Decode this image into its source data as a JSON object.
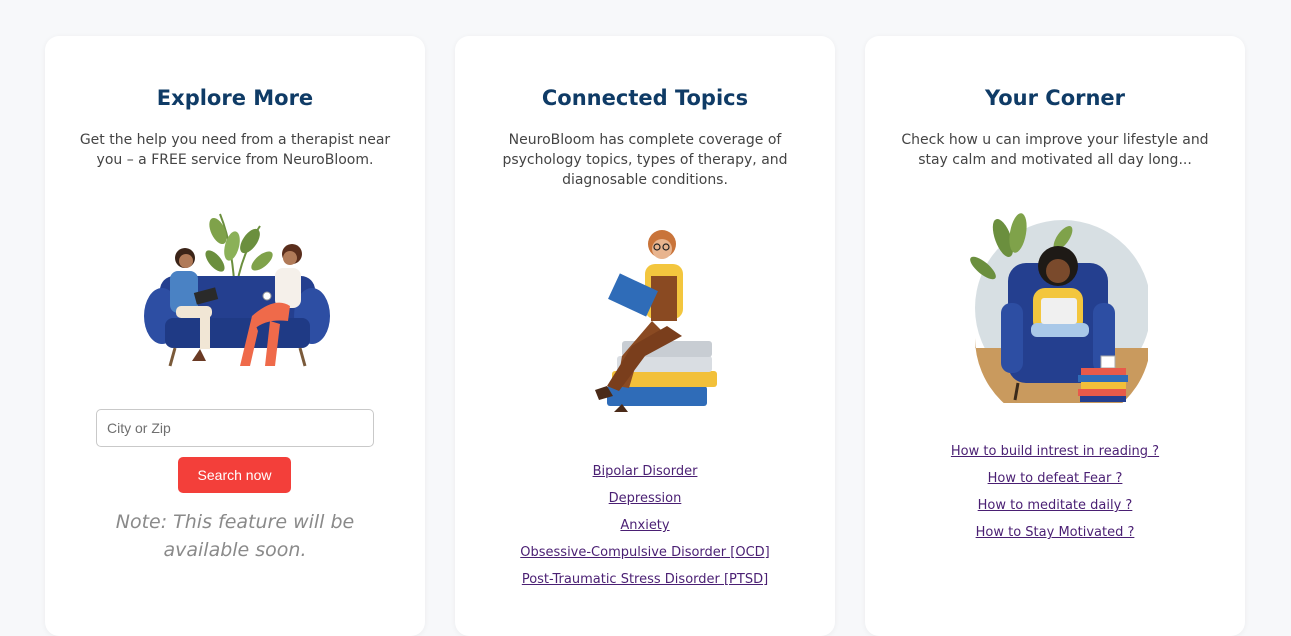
{
  "cards": [
    {
      "title": "Explore More",
      "description": "Get the help you need from a therapist near you – a FREE service from NeuroBloom.",
      "search": {
        "placeholder": "City or Zip",
        "button_label": "Search now"
      },
      "note": "Note: This feature will be available soon."
    },
    {
      "title": "Connected Topics",
      "description": "NeuroBloom has complete coverage of psychology topics, types of therapy, and diagnosable conditions.",
      "links": [
        "Bipolar Disorder",
        "Depression",
        "Anxiety",
        "Obsessive-Compulsive Disorder [OCD]",
        "Post-Traumatic Stress Disorder [PTSD]"
      ]
    },
    {
      "title": "Your Corner",
      "description": "Check how u can improve your lifestyle and stay calm and motivated all day long...",
      "links": [
        "How to build intrest in reading ?",
        "How to defeat Fear ?",
        "How to meditate daily ?",
        "How to Stay Motivated ?"
      ]
    }
  ],
  "colors": {
    "title": "#0f3b66",
    "button": "#f33f3a",
    "link": "#4a1f73",
    "sofa": "#243f8f"
  }
}
